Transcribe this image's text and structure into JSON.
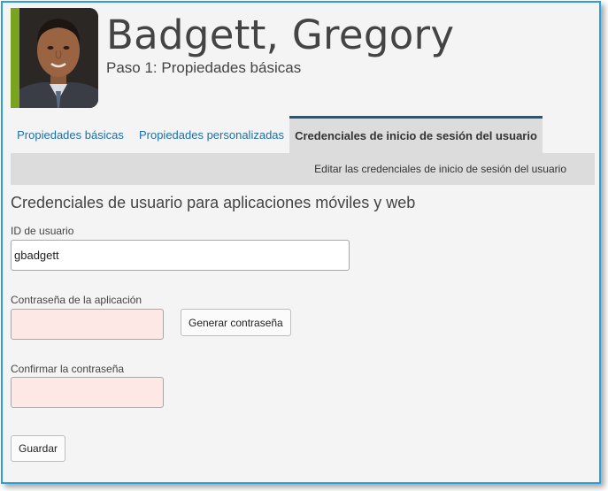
{
  "header": {
    "name": "Badgett, Gregory",
    "step": "Paso 1: Propiedades básicas"
  },
  "tabs": [
    {
      "label": "Propiedades básicas",
      "active": false
    },
    {
      "label": "Propiedades personalizadas",
      "active": false
    },
    {
      "label": "Credenciales de inicio de sesión del usuario",
      "active": true
    }
  ],
  "subbar": {
    "label": "Editar las credenciales de inicio de sesión del usuario"
  },
  "form": {
    "section_title": "Credenciales de usuario para aplicaciones móviles y web",
    "user_id": {
      "label": "ID de usuario",
      "value": "gbadgett"
    },
    "app_password": {
      "label": "Contraseña de la aplicación",
      "value": ""
    },
    "generate_button": "Generar contraseña",
    "confirm_password": {
      "label": "Confirmar la contraseña",
      "value": ""
    },
    "save_button": "Guardar"
  },
  "colors": {
    "accent_green": "#7aa320",
    "frame_blue": "#2a9fd8",
    "tab_link": "#1f6fa5",
    "active_tab_border": "#1e5a7d",
    "invalid_field": "#fde8e6"
  }
}
